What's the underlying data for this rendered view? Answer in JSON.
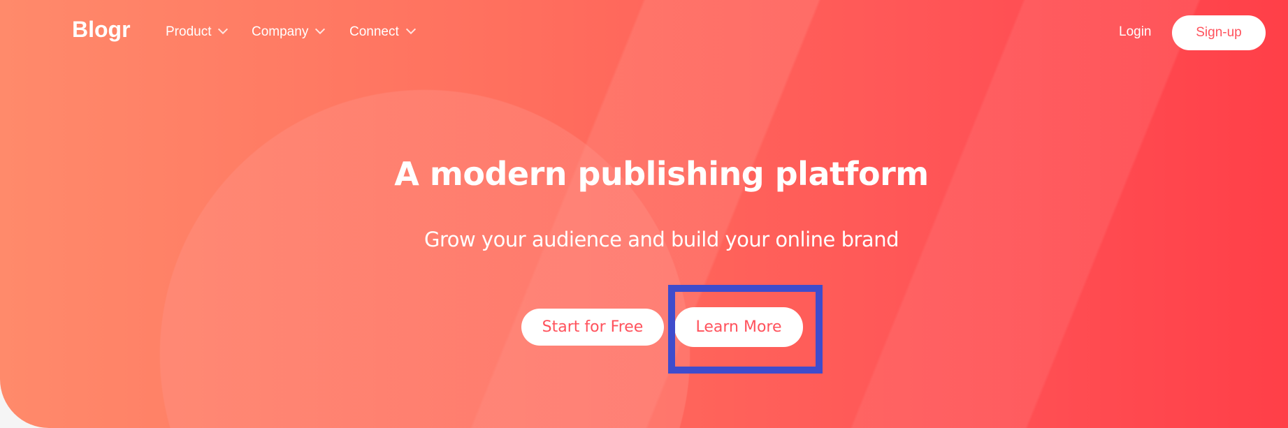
{
  "nav": {
    "logo": "Blogr",
    "items": [
      {
        "label": "Product",
        "icon": "chevron-down-icon"
      },
      {
        "label": "Company",
        "icon": "chevron-down-icon"
      },
      {
        "label": "Connect",
        "icon": "chevron-down-icon"
      }
    ],
    "login": "Login",
    "signup": "Sign-up"
  },
  "hero": {
    "title": "A modern publishing platform",
    "subtitle": "Grow your audience and build your online brand",
    "primary_button": "Start for Free",
    "secondary_button": "Learn More"
  },
  "colors": {
    "accent": "#ff525c",
    "highlight": "#3f4ccc",
    "gradient_start": "#ff8a6b",
    "gradient_end": "#ff3f48"
  }
}
